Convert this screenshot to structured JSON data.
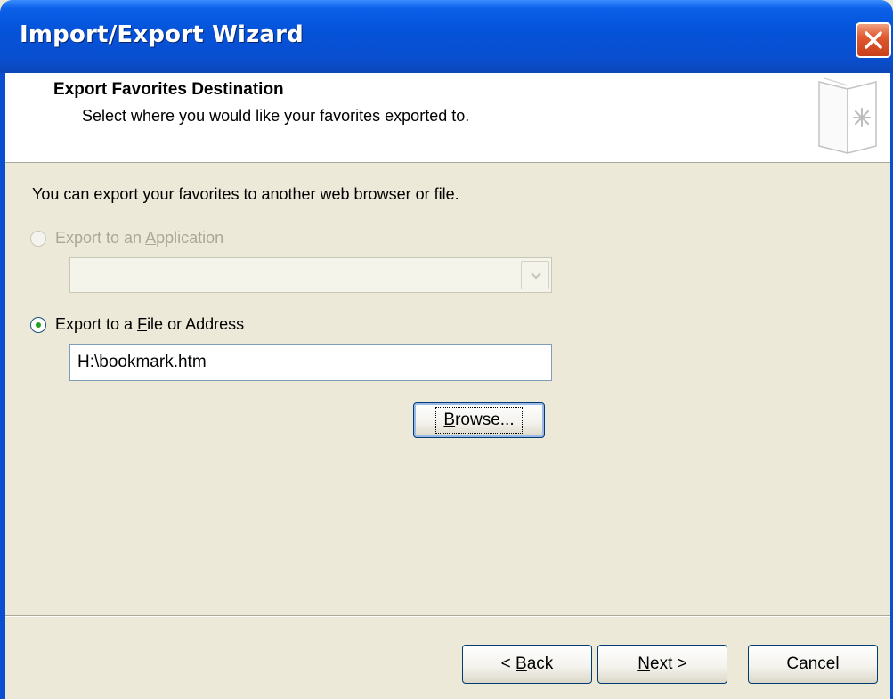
{
  "window": {
    "title": "Import/Export Wizard"
  },
  "header": {
    "title": "Export Favorites Destination",
    "subtitle": "Select where you would like your favorites exported to.",
    "icon": "document-star-icon"
  },
  "intro_text": "You can export your favorites to another web browser or file.",
  "options": {
    "application": {
      "label_prefix": "Export to an ",
      "label_mnemonic": "A",
      "label_suffix": "pplication",
      "selected": false,
      "enabled": false,
      "combo_value": ""
    },
    "file": {
      "label_prefix": "Export to a ",
      "label_mnemonic": "F",
      "label_suffix": "ile or Address",
      "selected": true,
      "enabled": true,
      "path_value": "H:\\bookmark.htm"
    }
  },
  "buttons": {
    "browse": {
      "mnemonic": "B",
      "rest": "rowse..."
    },
    "back": {
      "prefix": "< ",
      "mnemonic": "B",
      "rest": "ack"
    },
    "next": {
      "mnemonic": "N",
      "rest": "ext >"
    },
    "cancel": {
      "label": "Cancel"
    }
  },
  "colors": {
    "titlebar": "#0452d8",
    "dialog_bg": "#ece9d8",
    "close_button": "#e05a30",
    "radio_dot": "#21a121"
  }
}
